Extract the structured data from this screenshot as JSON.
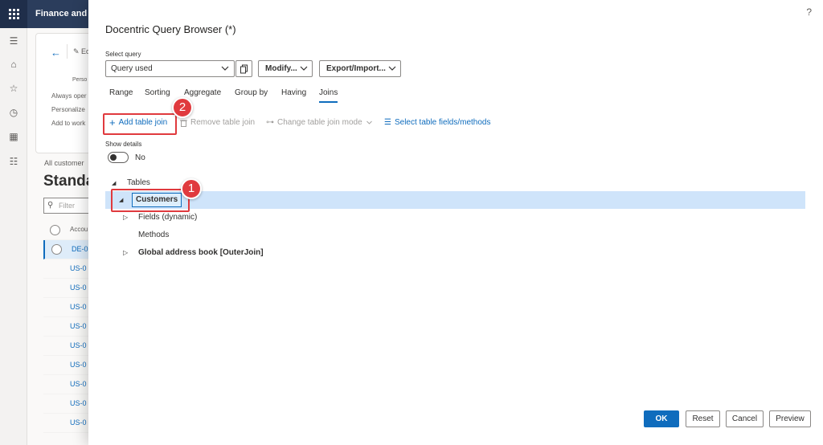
{
  "app": {
    "title": "Finance and"
  },
  "background": {
    "edit_label": "Edi",
    "card_small_label": "Perso",
    "card_links": [
      "Always oper",
      "Personalize",
      "Add to work"
    ],
    "all_customers": "All customer",
    "view_title": "Standa",
    "filter_placeholder": "Filter",
    "grid_header": "Accou",
    "grid_rows": [
      "DE-0",
      "US-0",
      "US-0",
      "US-0",
      "US-0",
      "US-0",
      "US-0",
      "US-0",
      "US-0",
      "US-0"
    ]
  },
  "dialog": {
    "title": "Docentric Query Browser (*)",
    "help": "?",
    "select_query_label": "Select query",
    "select_query_value": "Query used",
    "modify_label": "Modify...",
    "export_label": "Export/Import...",
    "tabs": [
      "Range",
      "Sorting",
      "Aggregate",
      "Group by",
      "Having",
      "Joins"
    ],
    "active_tab": "Joins",
    "actions": {
      "add_table_join": "Add table join",
      "remove_table_join": "Remove table join",
      "change_join_mode": "Change table join mode",
      "select_fields": "Select table fields/methods"
    },
    "show_details_label": "Show details",
    "show_details_value": "No",
    "tree": {
      "root": "Tables",
      "customers": "Customers",
      "fields": "Fields (dynamic)",
      "methods": "Methods",
      "global_address_book": "Global address book [OuterJoin]"
    },
    "buttons": {
      "ok": "OK",
      "reset": "Reset",
      "cancel": "Cancel",
      "preview": "Preview"
    }
  },
  "annotations": {
    "step1": "1",
    "step2": "2"
  },
  "colors": {
    "accent": "#0f6cbd",
    "highlight": "#e03a3e",
    "topbar": "#2b3d5c",
    "selected_row": "#cfe4fa"
  }
}
